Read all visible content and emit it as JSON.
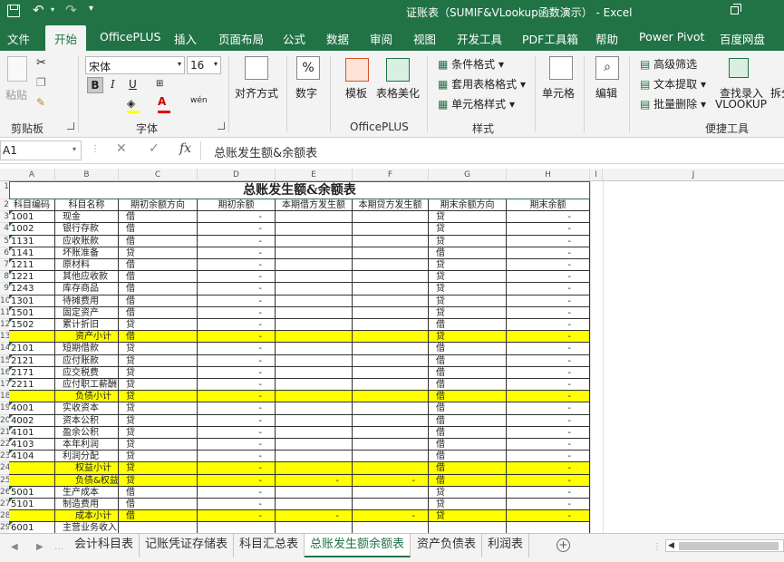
{
  "window": {
    "title": "证账表（SUMIF&VLookup函数演示） -  Excel"
  },
  "ribbon_tabs": [
    "文件",
    "开始",
    "OfficePLUS",
    "插入",
    "页面布局",
    "公式",
    "数据",
    "审阅",
    "视图",
    "开发工具",
    "PDF工具箱",
    "帮助",
    "Power Pivot",
    "百度网盘"
  ],
  "ribbon": {
    "paste": "粘贴",
    "clipboard": "剪贴板",
    "font_name": "宋体",
    "font_size": "16",
    "font_group": "字体",
    "align": "对齐方式",
    "number": "数字",
    "number_symbol": "%",
    "template": "模板",
    "table_beautify": "表格美化",
    "officeplus_group": "OfficePLUS",
    "cond_format": "条件格式",
    "table_format": "套用表格格式",
    "cell_style": "单元格样式",
    "style_group": "样式",
    "cells": "单元格",
    "edit": "编辑",
    "adv_filter": "高级筛选",
    "text_extract": "文本提取",
    "batch_delete": "批量删除",
    "find_record": "查找录入",
    "vlookup": "VLOOKUP",
    "split": "拆分",
    "tools_group": "便捷工具"
  },
  "formula_bar": {
    "name_box": "A1",
    "content": "总账发生额&余额表"
  },
  "columns": [
    "A",
    "B",
    "C",
    "D",
    "E",
    "F",
    "G",
    "H",
    "I",
    "J"
  ],
  "row_numbers": [
    "1",
    "2",
    "3",
    "4",
    "5",
    "6",
    "7",
    "8",
    "9",
    "10",
    "11",
    "12",
    "13",
    "14",
    "15",
    "16",
    "17",
    "18",
    "19",
    "20",
    "21",
    "22",
    "23",
    "24",
    "25",
    "26",
    "27",
    "28",
    "29"
  ],
  "sheet": {
    "title": "总账发生额&余额表",
    "headers": [
      "科目编码",
      "科目名称",
      "期初余额方向",
      "期初余额",
      "本期借方发生额",
      "本期贷方发生额",
      "期末余额方向",
      "期末余额"
    ],
    "rows": [
      {
        "code": "1001",
        "name": "现金",
        "dir1": "借",
        "open": "-",
        "debit": "",
        "credit": "",
        "dir2": "贷",
        "close": "-",
        "yellow": false
      },
      {
        "code": "1002",
        "name": "银行存款",
        "dir1": "借",
        "open": "-",
        "debit": "",
        "credit": "",
        "dir2": "贷",
        "close": "-",
        "yellow": false
      },
      {
        "code": "1131",
        "name": "应收账款",
        "dir1": "借",
        "open": "-",
        "debit": "",
        "credit": "",
        "dir2": "贷",
        "close": "-",
        "yellow": false
      },
      {
        "code": "1141",
        "name": "坏账准备",
        "dir1": "贷",
        "open": "-",
        "debit": "",
        "credit": "",
        "dir2": "借",
        "close": "-",
        "yellow": false
      },
      {
        "code": "1211",
        "name": "原材料",
        "dir1": "借",
        "open": "-",
        "debit": "",
        "credit": "",
        "dir2": "贷",
        "close": "-",
        "yellow": false
      },
      {
        "code": "1221",
        "name": "其他应收款",
        "dir1": "借",
        "open": "-",
        "debit": "",
        "credit": "",
        "dir2": "贷",
        "close": "-",
        "yellow": false
      },
      {
        "code": "1243",
        "name": "库存商品",
        "dir1": "借",
        "open": "-",
        "debit": "",
        "credit": "",
        "dir2": "贷",
        "close": "-",
        "yellow": false
      },
      {
        "code": "1301",
        "name": "待摊费用",
        "dir1": "借",
        "open": "-",
        "debit": "",
        "credit": "",
        "dir2": "贷",
        "close": "-",
        "yellow": false
      },
      {
        "code": "1501",
        "name": "固定资产",
        "dir1": "借",
        "open": "-",
        "debit": "",
        "credit": "",
        "dir2": "贷",
        "close": "-",
        "yellow": false
      },
      {
        "code": "1502",
        "name": "累计折旧",
        "dir1": "贷",
        "open": "-",
        "debit": "",
        "credit": "",
        "dir2": "借",
        "close": "-",
        "yellow": false
      },
      {
        "code": "",
        "name": "资产小计",
        "dir1": "借",
        "open": "-",
        "debit": "",
        "credit": "",
        "dir2": "贷",
        "close": "-",
        "yellow": true
      },
      {
        "code": "2101",
        "name": "短期借款",
        "dir1": "贷",
        "open": "-",
        "debit": "",
        "credit": "",
        "dir2": "借",
        "close": "-",
        "yellow": false
      },
      {
        "code": "2121",
        "name": "应付账款",
        "dir1": "贷",
        "open": "-",
        "debit": "",
        "credit": "",
        "dir2": "借",
        "close": "-",
        "yellow": false
      },
      {
        "code": "2171",
        "name": "应交税费",
        "dir1": "贷",
        "open": "-",
        "debit": "",
        "credit": "",
        "dir2": "借",
        "close": "-",
        "yellow": false
      },
      {
        "code": "2211",
        "name": "应付职工薪酬",
        "dir1": "贷",
        "open": "-",
        "debit": "",
        "credit": "",
        "dir2": "借",
        "close": "-",
        "yellow": false
      },
      {
        "code": "",
        "name": "负债小计",
        "dir1": "贷",
        "open": "-",
        "debit": "",
        "credit": "",
        "dir2": "借",
        "close": "-",
        "yellow": true
      },
      {
        "code": "4001",
        "name": "实收资本",
        "dir1": "贷",
        "open": "-",
        "debit": "",
        "credit": "",
        "dir2": "借",
        "close": "-",
        "yellow": false
      },
      {
        "code": "4002",
        "name": "资本公积",
        "dir1": "贷",
        "open": "-",
        "debit": "",
        "credit": "",
        "dir2": "借",
        "close": "-",
        "yellow": false
      },
      {
        "code": "4101",
        "name": "盈余公积",
        "dir1": "贷",
        "open": "-",
        "debit": "",
        "credit": "",
        "dir2": "借",
        "close": "-",
        "yellow": false
      },
      {
        "code": "4103",
        "name": "本年利润",
        "dir1": "贷",
        "open": "-",
        "debit": "",
        "credit": "",
        "dir2": "借",
        "close": "-",
        "yellow": false
      },
      {
        "code": "4104",
        "name": "利润分配",
        "dir1": "贷",
        "open": "-",
        "debit": "",
        "credit": "",
        "dir2": "借",
        "close": "-",
        "yellow": false
      },
      {
        "code": "",
        "name": "权益小计",
        "dir1": "贷",
        "open": "-",
        "debit": "",
        "credit": "",
        "dir2": "借",
        "close": "-",
        "yellow": true
      },
      {
        "code": "",
        "name": "负债&权益合计",
        "dir1": "贷",
        "open": "-",
        "debit": "-",
        "credit": "-",
        "dir2": "借",
        "close": "-",
        "yellow": true
      },
      {
        "code": "5001",
        "name": "生产成本",
        "dir1": "借",
        "open": "-",
        "debit": "",
        "credit": "",
        "dir2": "贷",
        "close": "-",
        "yellow": false
      },
      {
        "code": "5101",
        "name": "制造费用",
        "dir1": "借",
        "open": "-",
        "debit": "",
        "credit": "",
        "dir2": "贷",
        "close": "-",
        "yellow": false
      },
      {
        "code": "",
        "name": "成本小计",
        "dir1": "借",
        "open": "-",
        "debit": "-",
        "credit": "-",
        "dir2": "贷",
        "close": "-",
        "yellow": true
      },
      {
        "code": "6001",
        "name": "主营业务收入",
        "dir1": "",
        "open": "",
        "debit": "",
        "credit": "",
        "dir2": "",
        "close": "",
        "yellow": false
      }
    ]
  },
  "sheet_tabs": [
    "会计科目表",
    "记账凭证存储表",
    "科目汇总表",
    "总账发生额余额表",
    "资产负债表",
    "利润表"
  ],
  "active_sheet": "总账发生额余额表",
  "colors": {
    "excel_green": "#217346",
    "highlight": "#ffff00"
  }
}
